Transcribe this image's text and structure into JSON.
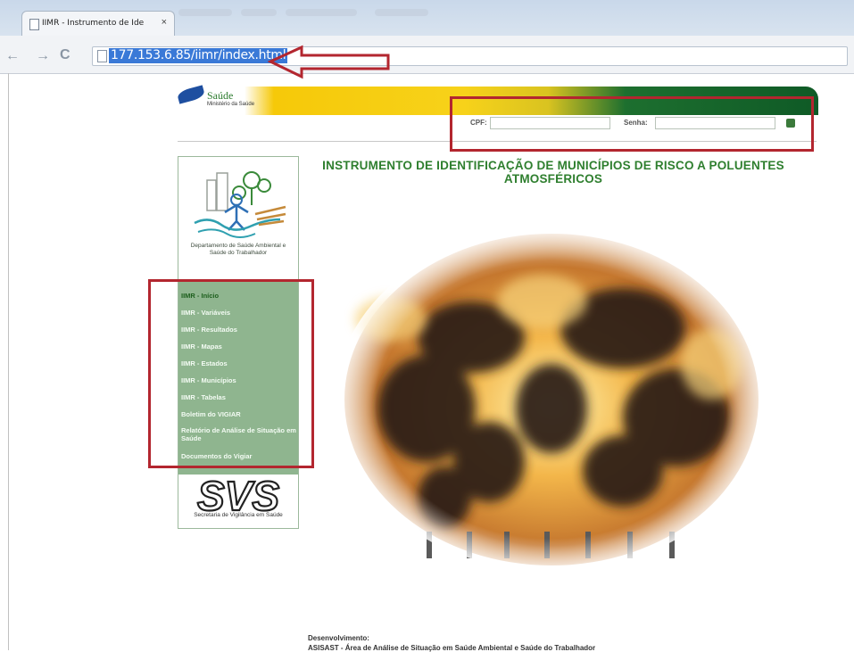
{
  "browser": {
    "tab_title": "IIMR - Instrumento de Ide",
    "tab_close": "×",
    "url": "177.153.6.85/iimr/index.html",
    "back_glyph": "←",
    "forward_glyph": "→",
    "reload_glyph": "C"
  },
  "header": {
    "logo_title": "Saúde",
    "logo_subtitle": "Ministério da Saúde",
    "cpf_label": "CPF:",
    "senha_label": "Senha:",
    "cpf_value": "",
    "senha_value": ""
  },
  "sidebar": {
    "dept_name": "Departamento de Saúde Ambiental e Saúde do Trabalhador",
    "items": [
      {
        "label": "IIMR - Início"
      },
      {
        "label": "IIMR - Variáveis"
      },
      {
        "label": "IIMR - Resultados"
      },
      {
        "label": "IIMR - Mapas"
      },
      {
        "label": "IIMR - Estados"
      },
      {
        "label": "IIMR - Municípios"
      },
      {
        "label": "IIMR - Tabelas"
      },
      {
        "label": "Boletim do VIGIAR"
      },
      {
        "label": "Relatório de Análise de Situação em Saúde"
      },
      {
        "label": "Documentos do Vigiar"
      }
    ],
    "svs_logo": "SVS",
    "svs_caption": "Secretaria de Vigilância em Saúde"
  },
  "main": {
    "headline_line1": "INSTRUMENTO DE IDENTIFICAÇÃO DE MUNICÍPIOS DE RISCO A POLUENTES",
    "headline_line2": "ATMOSFÉRICOS",
    "credits_label": "Desenvolvimento:",
    "credits_text": "ASISAST - Área de Análise de Situação em Saúde Ambiental e Saúde do Trabalhador"
  },
  "colors": {
    "highlight": "#b3262f",
    "menu_bg": "#8fb58f",
    "headline": "#2f7f2f"
  },
  "icons": [
    "page-icon",
    "arrow-annotation-icon",
    "login-submit-icon"
  ]
}
